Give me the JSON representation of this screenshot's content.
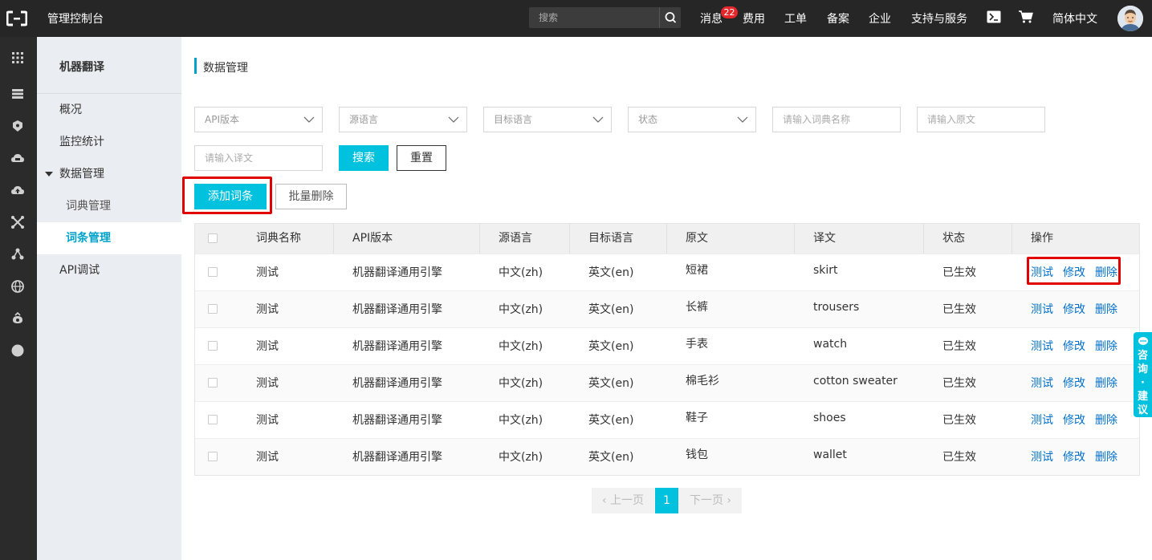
{
  "topbar": {
    "title": "管理控制台",
    "search_placeholder": "搜索",
    "nav": {
      "messages": "消息",
      "messages_badge": "22",
      "billing": "费用",
      "tickets": "工单",
      "icp": "备案",
      "enterprise": "企业",
      "support": "支持与服务",
      "language": "简体中文"
    }
  },
  "sidebar": {
    "product_title": "机器翻译",
    "items": {
      "overview": "概况",
      "monitor": "监控统计",
      "data_mgmt": "数据管理",
      "dict_mgmt": "词典管理",
      "entry_mgmt": "词条管理",
      "api_debug": "API调试"
    }
  },
  "page": {
    "title": "数据管理"
  },
  "filters": {
    "api_version": "API版本",
    "source_lang": "源语言",
    "target_lang": "目标语言",
    "status": "状态",
    "dict_name_placeholder": "请输入词典名称",
    "source_text_placeholder": "请输入原文",
    "translation_placeholder": "请输入译文",
    "search_label": "搜索",
    "reset_label": "重置"
  },
  "actions": {
    "add_entry": "添加词条",
    "batch_delete": "批量删除"
  },
  "table": {
    "headers": {
      "dict_name": "词典名称",
      "api_version": "API版本",
      "source_lang": "源语言",
      "target_lang": "目标语言",
      "source_text": "原文",
      "translation": "译文",
      "status": "状态",
      "actions": "操作"
    },
    "rows": [
      {
        "dict_name": "测试",
        "api_version": "机器翻译通用引擎",
        "source_lang": "中文(zh)",
        "target_lang": "英文(en)",
        "source_text": "短裙",
        "translation": "skirt",
        "status": "已生效"
      },
      {
        "dict_name": "测试",
        "api_version": "机器翻译通用引擎",
        "source_lang": "中文(zh)",
        "target_lang": "英文(en)",
        "source_text": "长裤",
        "translation": "trousers",
        "status": "已生效"
      },
      {
        "dict_name": "测试",
        "api_version": "机器翻译通用引擎",
        "source_lang": "中文(zh)",
        "target_lang": "英文(en)",
        "source_text": "手表",
        "translation": "watch",
        "status": "已生效"
      },
      {
        "dict_name": "测试",
        "api_version": "机器翻译通用引擎",
        "source_lang": "中文(zh)",
        "target_lang": "英文(en)",
        "source_text": "棉毛衫",
        "translation": "cotton sweater",
        "status": "已生效"
      },
      {
        "dict_name": "测试",
        "api_version": "机器翻译通用引擎",
        "source_lang": "中文(zh)",
        "target_lang": "英文(en)",
        "source_text": "鞋子",
        "translation": "shoes",
        "status": "已生效"
      },
      {
        "dict_name": "测试",
        "api_version": "机器翻译通用引擎",
        "source_lang": "中文(zh)",
        "target_lang": "英文(en)",
        "source_text": "钱包",
        "translation": "wallet",
        "status": "已生效"
      }
    ],
    "row_actions": {
      "test": "测试",
      "edit": "修改",
      "delete": "删除"
    }
  },
  "pagination": {
    "prev": "上一页",
    "current": "1",
    "next": "下一页"
  },
  "consult": {
    "chars": [
      "咨",
      "询",
      "·",
      "建",
      "议"
    ]
  },
  "colors": {
    "accent": "#00c1de",
    "topbar": "#262626",
    "link": "#0070cc",
    "badge": "#e5262b",
    "highlight": "#e00000"
  }
}
